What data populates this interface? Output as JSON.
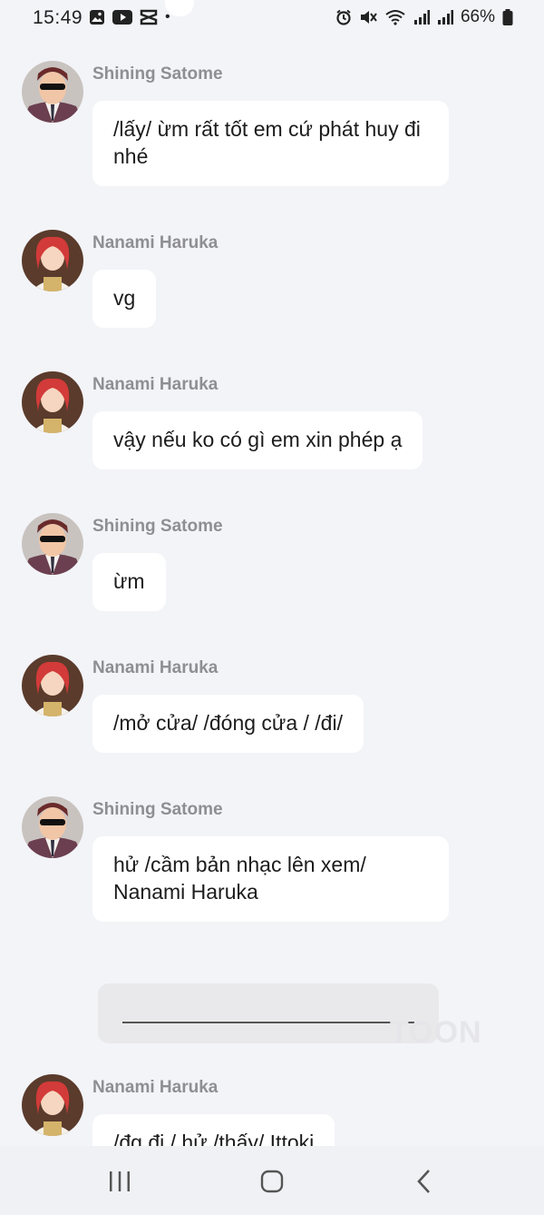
{
  "status_bar": {
    "time": "15:49",
    "dot": "•",
    "battery": "66%"
  },
  "messages": [
    {
      "sender": "Shining Satome",
      "text": "/lấy/ ừm rất tốt em cứ phát huy đi nhé",
      "avatar": "satome"
    },
    {
      "sender": "Nanami Haruka",
      "text": "vg",
      "avatar": "haruka"
    },
    {
      "sender": "Nanami Haruka",
      "text": "vậy nếu ko có gì em xin phép ạ",
      "avatar": "haruka"
    },
    {
      "sender": "Shining Satome",
      "text": "ừm",
      "avatar": "satome"
    },
    {
      "sender": "Nanami Haruka",
      "text": "/mở cửa/ /đóng cửa / /đi/",
      "avatar": "haruka"
    },
    {
      "sender": "Shining Satome",
      "text": "hử /cầm bản nhạc lên xem/ Nanami Haruka",
      "avatar": "satome"
    },
    {
      "sender": "Nanami Haruka",
      "text": "/đg đi / hử /thấy/ Ittoki",
      "avatar": "haruka"
    }
  ],
  "watermark": "TOON",
  "nav": {
    "recents": "recents",
    "home": "home",
    "back": "back"
  }
}
